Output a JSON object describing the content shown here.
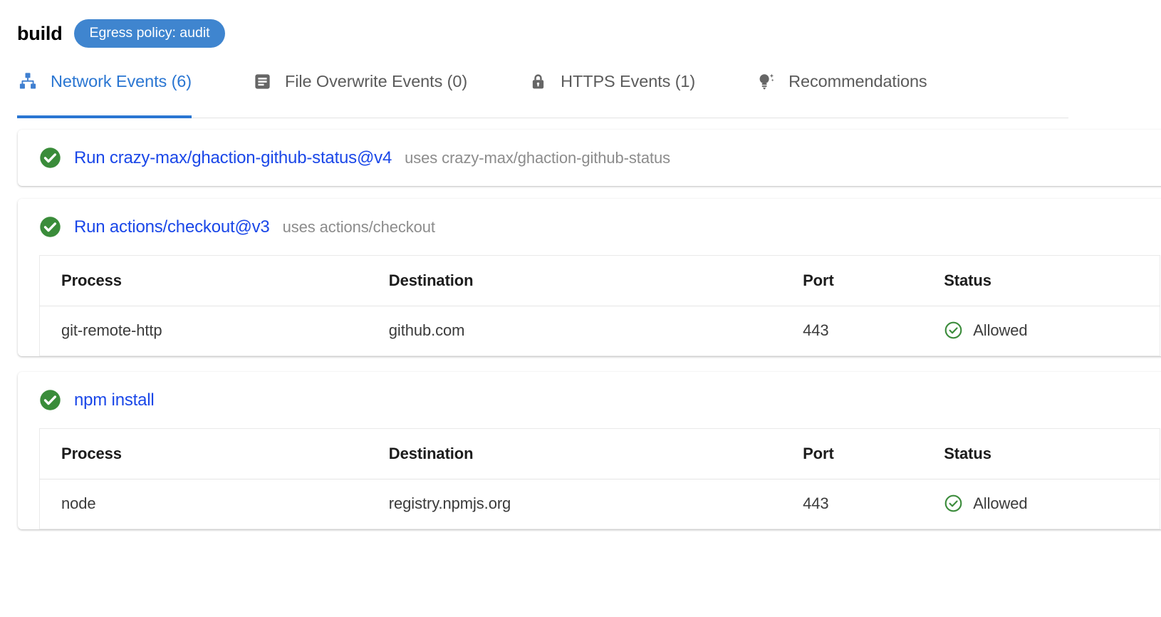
{
  "header": {
    "job_name": "build",
    "policy_badge": "Egress policy: audit",
    "badge_color": "#3f85cf"
  },
  "tabs": [
    {
      "id": "network-events",
      "label": "Network Events (6)",
      "icon": "account-tree-icon",
      "active": true,
      "color": "#2a76d2"
    },
    {
      "id": "file-overwrite-events",
      "label": "File Overwrite Events (0)",
      "icon": "article-icon",
      "active": false,
      "color": "#5b5b5b"
    },
    {
      "id": "https-events",
      "label": "HTTPS Events (1)",
      "icon": "lock-icon",
      "active": false,
      "color": "#5b5b5b"
    },
    {
      "id": "recommendations",
      "label": "Recommendations",
      "icon": "lightbulb-icon",
      "active": false,
      "color": "#5b5b5b"
    }
  ],
  "table_headers": {
    "process": "Process",
    "destination": "Destination",
    "port": "Port",
    "status": "Status"
  },
  "steps": [
    {
      "status_icon": "check-circle-filled-icon",
      "name": "Run crazy-max/ghaction-github-status@v4",
      "uses": "uses crazy-max/ghaction-github-status",
      "rows": []
    },
    {
      "status_icon": "check-circle-filled-icon",
      "name": "Run actions/checkout@v3",
      "uses": "uses actions/checkout",
      "rows": [
        {
          "process": "git-remote-http",
          "destination": "github.com",
          "port": "443",
          "status": "Allowed",
          "status_icon": "check-circle-outline-icon"
        }
      ]
    },
    {
      "status_icon": "check-circle-filled-icon",
      "name": "npm install",
      "uses": "",
      "rows": [
        {
          "process": "node",
          "destination": "registry.npmjs.org",
          "port": "443",
          "status": "Allowed",
          "status_icon": "check-circle-outline-icon"
        }
      ]
    }
  ],
  "colors": {
    "link": "#1a47e8",
    "muted": "#8c8c8c",
    "success_fill": "#3a8c3a",
    "success_outline": "#3c8c3c",
    "tab_active": "#2a76d2",
    "tab_inactive": "#5b5b5b"
  }
}
